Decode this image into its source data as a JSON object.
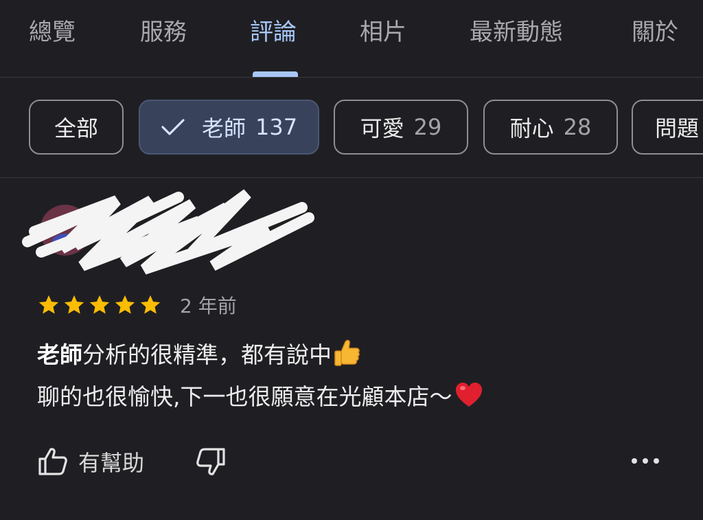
{
  "tabs": [
    {
      "label": "總覽",
      "active": false
    },
    {
      "label": "服務",
      "active": false
    },
    {
      "label": "評論",
      "active": true
    },
    {
      "label": "相片",
      "active": false
    },
    {
      "label": "最新動態",
      "active": false
    },
    {
      "label": "關於",
      "active": false
    }
  ],
  "chips": [
    {
      "label": "全部",
      "count": ""
    },
    {
      "label": "老師",
      "count": "137",
      "selected": true
    },
    {
      "label": "可愛",
      "count": "29"
    },
    {
      "label": "耐心",
      "count": "28"
    },
    {
      "label": "問題",
      "count": ""
    }
  ],
  "review": {
    "rating": 5,
    "time": "2 年前",
    "highlight": "老師",
    "line1_rest": "分析的很精準，都有說中",
    "line2": "聊的也很愉快,下一也很願意在光顧本店～"
  },
  "actions": {
    "helpful_label": "有幫助"
  },
  "colors": {
    "background": "#1f1f23",
    "accent": "#a8c7fa",
    "star": "#fbbc04",
    "chip_selected_bg": "#38425a"
  }
}
